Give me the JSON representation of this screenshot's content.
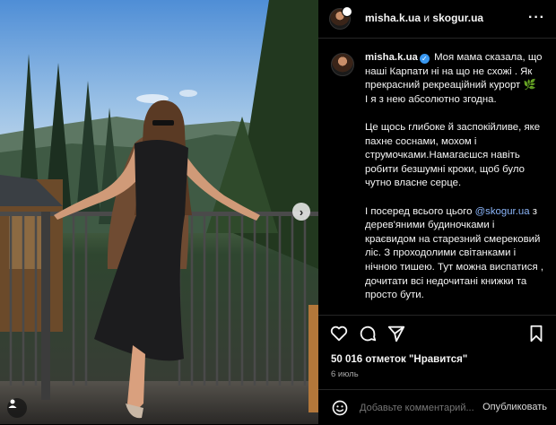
{
  "header": {
    "user_primary": "misha.k.ua",
    "connector": "и",
    "user_secondary": "skogur.ua",
    "more_icon": "more-horizontal-icon"
  },
  "caption": {
    "username": "misha.k.ua",
    "line1": "Моя мама сказала, що наші Карпати ні на що не схожі . Як прекрасний рекреаційний курорт",
    "fern": "🌿",
    "line2": "І я з нею абсолютно згодна.",
    "paragraph2": "Це щось глибоке й заспокійливе, яке пахне соснами, мохом і струмочками.Намагаєшся навіть робити безшумні кроки, щоб було чутно власне серце.",
    "p3_before": "І посеред всього цього ",
    "p3_mention": "@skogur.ua",
    "p3_after": " з дерев'яними будиночками і краєвидом на старезний смерековий ліс. З проходолими світанками і нічною тишею. Тут можна виспатися , дочитати всі недочитані книжки та просто бути."
  },
  "actions": {
    "like_icon": "heart-icon",
    "comment_icon": "comment-icon",
    "share_icon": "paper-plane-icon",
    "save_icon": "bookmark-icon"
  },
  "likes": "50 016 отметок \"Нравится\"",
  "date": "6 июль",
  "comment": {
    "placeholder": "Добавьте комментарий...",
    "post_label": "Опубликовать",
    "emoji_icon": "emoji-icon"
  },
  "photo": {
    "next_icon": "chevron-right-icon",
    "tag_icon": "user-tag-icon"
  },
  "colors": {
    "background": "#000000",
    "text": "#f5f5f5",
    "secondary_text": "#a8a8a8",
    "mention": "#8ab4f8",
    "verified": "#3897f0",
    "divider": "#262626"
  }
}
